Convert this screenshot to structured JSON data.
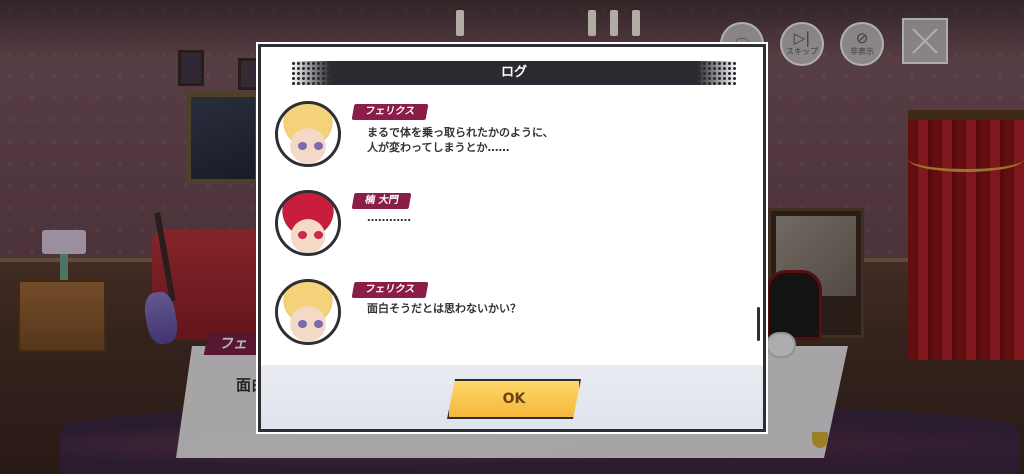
{
  "top_controls": {
    "log": {
      "icon": "chat-bubble-icon",
      "label": ""
    },
    "skip": {
      "icon": "skip-icon",
      "label": "スキップ"
    },
    "hide": {
      "icon": "hide-chat-icon",
      "label": "非表示"
    },
    "close": {
      "icon": "close-icon"
    }
  },
  "underlying_message": {
    "speaker_partial": "フェ",
    "text_partial": "面白"
  },
  "log_dialog": {
    "title": "ログ",
    "entries": [
      {
        "speaker": "フェリクス",
        "avatar": "felix-avatar",
        "lines": [
          "まるで体を乗っ取られたかのように、",
          "人が変わってしまうとか……"
        ]
      },
      {
        "speaker": "楠 大門",
        "avatar": "kusunoki-daimon-avatar",
        "lines": [
          "…………"
        ]
      },
      {
        "speaker": "フェリクス",
        "avatar": "felix-avatar",
        "lines": [
          "面白そうだとは思わないかい？"
        ]
      }
    ],
    "ok_label": "OK"
  },
  "colors": {
    "name_tag": "#8a1e48",
    "ok_button": "#f5b73a",
    "header_bar": "#2a2a30"
  }
}
